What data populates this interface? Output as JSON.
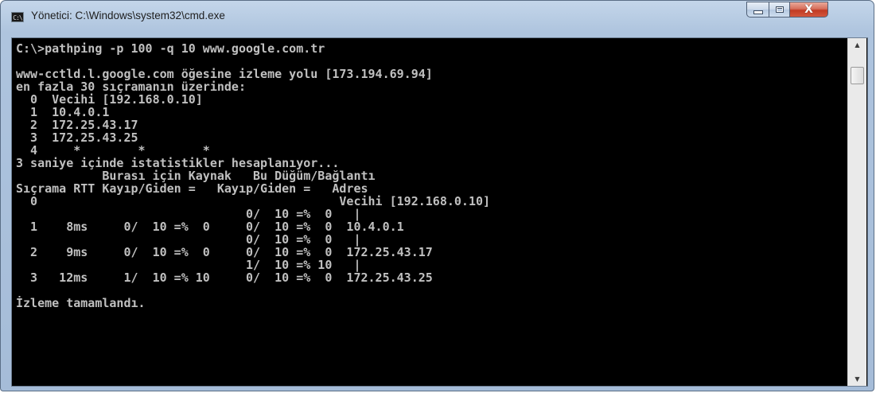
{
  "window": {
    "title": "Yönetici: C:\\Windows\\system32\\cmd.exe",
    "app_icon": "C:\\",
    "close_symbol": "X"
  },
  "console": {
    "lines": [
      "C:\\>pathping -p 100 -q 10 www.google.com.tr",
      "",
      "www-cctld.l.google.com öğesine izleme yolu [173.194.69.94]",
      "en fazla 30 sıçramanın üzerinde:",
      "  0  Vecihi [192.168.0.10]",
      "  1  10.4.0.1",
      "  2  172.25.43.17",
      "  3  172.25.43.25",
      "  4     *        *        *",
      "3 saniye içinde istatistikler hesaplanıyor...",
      "            Burası için Kaynak   Bu Düğüm/Bağlantı",
      "Sıçrama RTT Kayıp/Giden =   Kayıp/Giden =   Adres",
      "  0                                          Vecihi [192.168.0.10]",
      "                                0/  10 =%  0   |",
      "  1    8ms     0/  10 =%  0     0/  10 =%  0  10.4.0.1",
      "                                0/  10 =%  0   |",
      "  2    9ms     0/  10 =%  0     0/  10 =%  0  172.25.43.17",
      "                                1/  10 =% 10   |",
      "  3   12ms     1/  10 =% 10     0/  10 =%  0  172.25.43.25",
      "",
      "İzleme tamamlandı."
    ]
  },
  "scrollbar": {
    "up_arrow": "▲",
    "down_arrow": "▼"
  }
}
